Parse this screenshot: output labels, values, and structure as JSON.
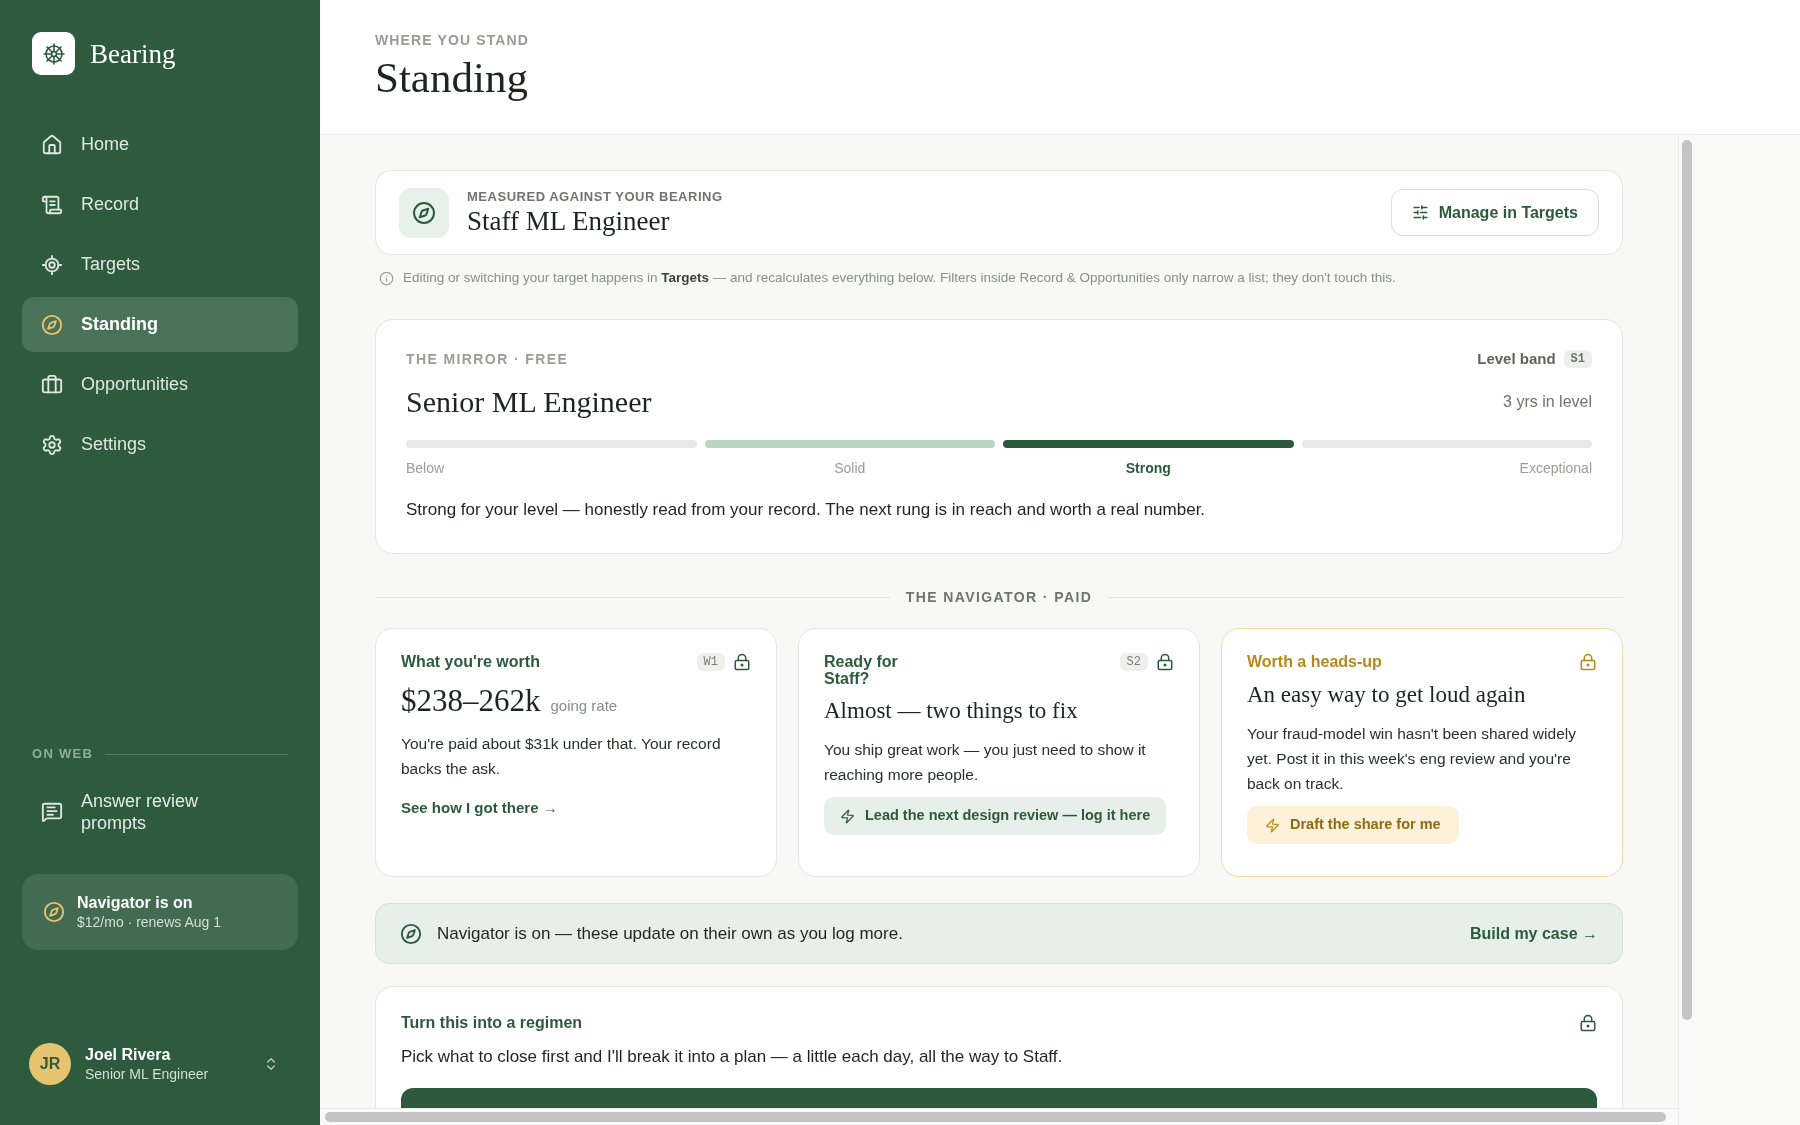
{
  "sidebar": {
    "brand": "Bearing",
    "nav": [
      {
        "label": "Home",
        "selected": false
      },
      {
        "label": "Record",
        "selected": false
      },
      {
        "label": "Targets",
        "selected": false
      },
      {
        "label": "Standing",
        "selected": true
      },
      {
        "label": "Opportunities",
        "selected": false
      },
      {
        "label": "Settings",
        "selected": false
      }
    ],
    "section_label": "ON WEB",
    "web_links": [
      {
        "label": "Answer review prompts"
      }
    ],
    "plan": {
      "title": "Navigator is on",
      "detail": "$12/mo · renews Aug 1"
    },
    "user": {
      "initials": "JR",
      "name": "Joel Rivera",
      "role": "Senior ML Engineer"
    }
  },
  "header": {
    "eyebrow": "WHERE YOU STAND",
    "title": "Standing"
  },
  "target": {
    "label": "MEASURED AGAINST YOUR BEARING",
    "title": "Staff ML Engineer",
    "button": "Manage in Targets"
  },
  "notice": "Editing or switching your target happens in **Targets** — and recalculates everything below. Filters inside Record & Opportunities only narrow a list; they don't touch this.",
  "mirror": {
    "eyebrow": "THE MIRROR · FREE",
    "band_label": "Level band",
    "band": "S1",
    "title": "Senior ML Engineer",
    "tenure": "3 yrs in level",
    "segments": [
      {
        "label": "Below",
        "selected": false,
        "filled": false
      },
      {
        "label": "Solid",
        "selected": false,
        "filled": true
      },
      {
        "label": "Strong",
        "selected": true,
        "filled": true
      },
      {
        "label": "Exceptional",
        "selected": false,
        "filled": false
      }
    ],
    "summary": "Strong for your level — honestly read from your record. The next rung is in reach and worth a real number."
  },
  "navigator": {
    "label": "THE NAVIGATOR · PAID",
    "cards": [
      {
        "kind": "worth",
        "title": "What you're worth",
        "badge": "W1",
        "locked": true,
        "amount": "$238–262k",
        "amount_note": "going rate",
        "body": "You're paid about $31k under that. Your record backs the ask.",
        "link": "See how I got there →"
      },
      {
        "kind": "readiness",
        "title": "Ready for\nStaff?",
        "badge": "S2",
        "locked": true,
        "heading": "Almost — two things to fix",
        "body": "You ship great work — you just need to show it reaching more people.",
        "action": "Lead the next design review — log it here"
      },
      {
        "kind": "alert",
        "title": "Worth a heads-up",
        "locked": true,
        "heading": "An easy way to get loud again",
        "body": "Your fraud-model win hasn't been shared widely yet. Post it in this week's eng review and you're back on track.",
        "action": "Draft the share for me"
      }
    ],
    "banner": {
      "text": "Navigator is on — these update on their own as you log more.",
      "link": "Build my case →"
    }
  },
  "regimen": {
    "title": "Turn this into a regimen",
    "locked": true,
    "body": "Pick what to close first and I'll break it into a plan — a little each day, all the way to Staff."
  }
}
